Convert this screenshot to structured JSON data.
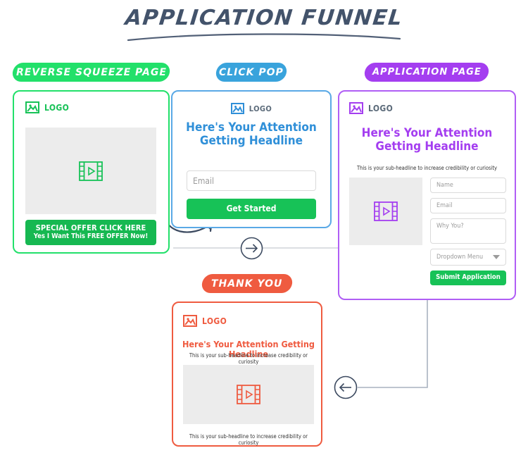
{
  "page": {
    "title": "APPLICATION FUNNEL"
  },
  "colors": {
    "title": "#43536b",
    "green": "#22e06a",
    "green_button": "#17c257",
    "blue": "#39a3dc",
    "blue_headline": "#2f8fd8",
    "purple": "#a43ef0",
    "orange": "#ef5b40",
    "placeholder_gray": "#ececec",
    "connector_gray": "#c9cdd4",
    "arrow": "#3c4a60"
  },
  "stages": {
    "reverse_squeeze": {
      "badge": "REVERSE SQUEEZE PAGE",
      "logo": "LOGO",
      "logo_icon": "image-icon",
      "media_icon": "film-play-icon",
      "cta_line1": "SPECIAL OFFER CLICK HERE",
      "cta_line2": "Yes I Want This FREE OFFER Now!"
    },
    "click_pop": {
      "badge": "CLICK POP",
      "logo": "LOGO",
      "logo_icon": "image-icon",
      "headline": "Here's Your Attention Getting Headline",
      "email_placeholder": "Email",
      "button": "Get Started"
    },
    "application_page": {
      "badge": "APPLICATION PAGE",
      "logo": "LOGO",
      "logo_icon": "image-icon",
      "headline": "Here's Your Attention Getting Headline",
      "subheadline": "This is your sub-headline to increase credibility or curiosity",
      "media_icon": "film-play-icon",
      "name_placeholder": "Name",
      "email_placeholder": "Email",
      "why_placeholder": "Why You?",
      "dropdown_label": "Dropdown Menu",
      "dropdown_icon": "chevron-down-icon",
      "button": "Submit Application"
    },
    "thank_you": {
      "badge": "THANK YOU",
      "logo": "LOGO",
      "logo_icon": "image-icon",
      "headline": "Here's Your Attention Getting Headline",
      "subheadline_top": "This is your sub-headline to increase credibility or curiosity",
      "media_icon": "film-play-icon",
      "subheadline_bottom": "This is your sub-headline to increase credibility or curiosity"
    }
  },
  "connectors": {
    "curved_arrow": "arrow-reverse-to-clickpop",
    "right_arrow": "arrow-right-circle",
    "left_arrow": "arrow-left-circle"
  }
}
